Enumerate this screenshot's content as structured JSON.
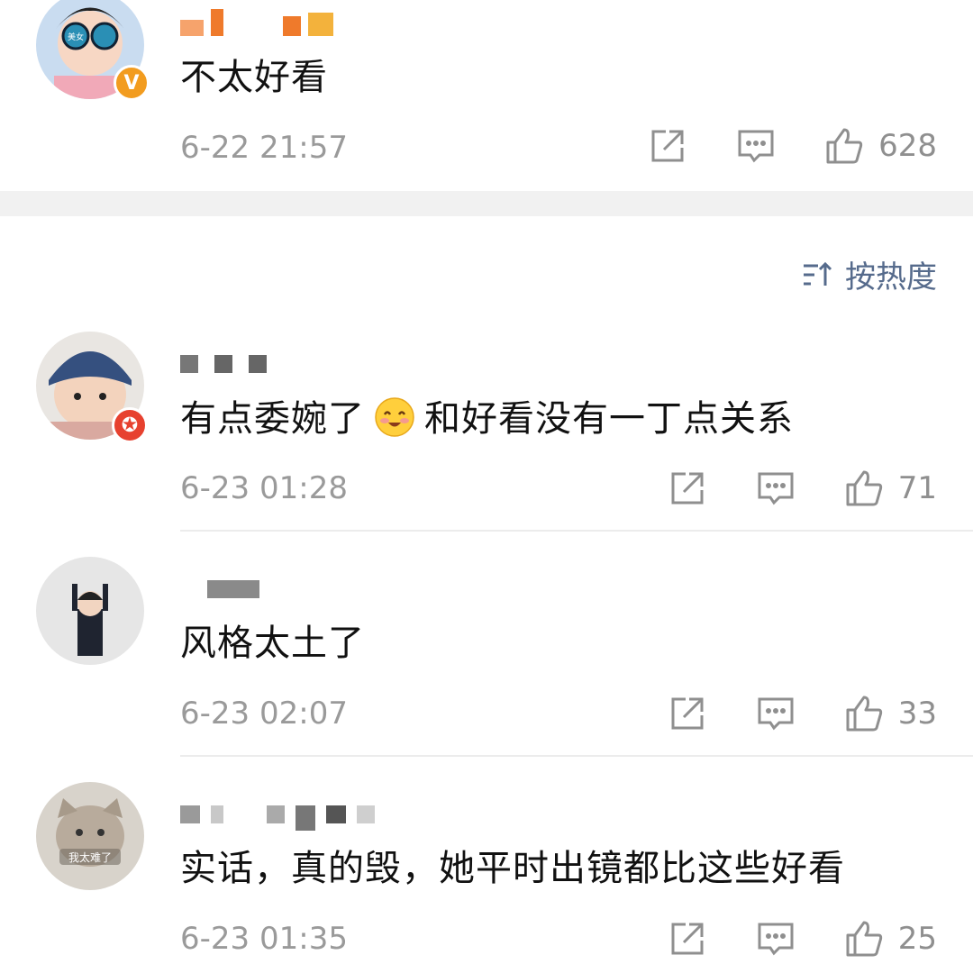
{
  "comments": [
    {
      "text": "不太好看",
      "time": "6-22 21:57",
      "likes": "628",
      "avatar_badge": "V",
      "avatar_label": "美女"
    },
    {
      "text_before": "有点委婉了",
      "text_after": "和好看没有一丁点关系",
      "emoji": "blush-emoji",
      "time": "6-23 01:28",
      "likes": "71",
      "avatar_badge": "✪"
    },
    {
      "text": "风格太土了",
      "time": "6-23 02:07",
      "likes": "33"
    },
    {
      "text": "实话，真的毁，她平时出镜都比这些好看",
      "time": "6-23 01:35",
      "likes": "25",
      "avatar_label": "我太难了"
    }
  ],
  "sort": {
    "label": "按热度",
    "icon": "sort-icon"
  },
  "icons": {
    "repost": "repost-icon",
    "reply": "comment-icon",
    "like": "like-icon"
  },
  "colors": {
    "accent": "#566b8c",
    "time": "#9a9a9a",
    "badge_gold": "#f29c1f",
    "badge_red": "#e7412f"
  }
}
